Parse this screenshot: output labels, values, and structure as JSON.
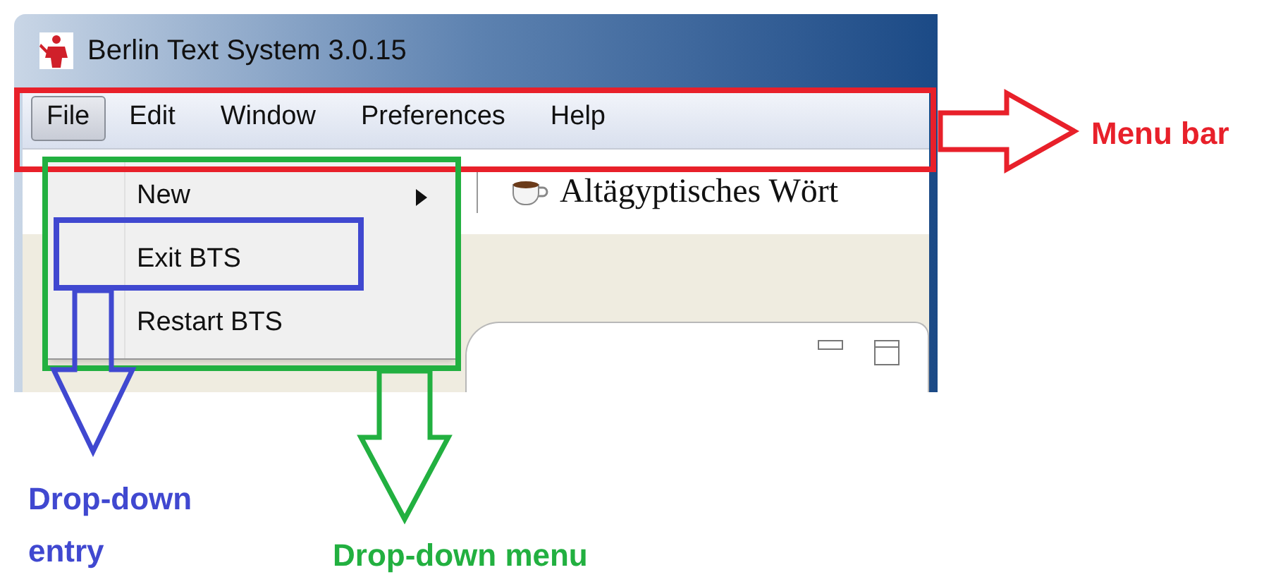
{
  "window": {
    "title": "Berlin Text System 3.0.15"
  },
  "menu_bar": {
    "items": [
      {
        "label": "File",
        "selected": true
      },
      {
        "label": "Edit",
        "selected": false
      },
      {
        "label": "Window",
        "selected": false
      },
      {
        "label": "Preferences",
        "selected": false
      },
      {
        "label": "Help",
        "selected": false
      }
    ]
  },
  "dropdown": {
    "items": [
      {
        "label": "New",
        "submenu": true
      },
      {
        "label": "Exit BTS",
        "submenu": false
      },
      {
        "label": "Restart BTS",
        "submenu": false
      }
    ]
  },
  "toolbar": {
    "dictionary_title": "Altägyptisches Wört"
  },
  "annotations": [
    {
      "label": "Menu bar",
      "color": "#e8202a"
    },
    {
      "label": "Drop-down entry",
      "color": "#4048d0"
    },
    {
      "label": "Drop-down menu",
      "color": "#22b040"
    }
  ]
}
